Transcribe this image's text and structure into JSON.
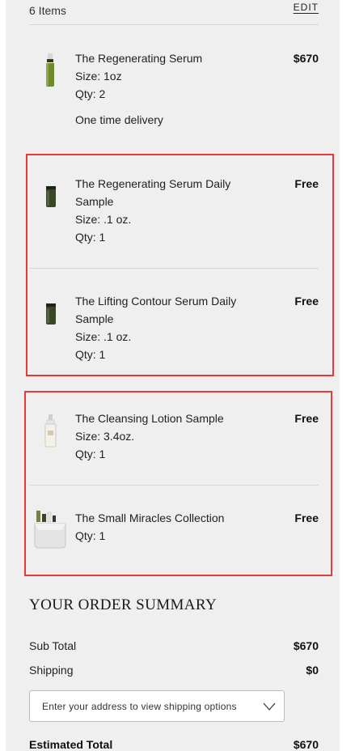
{
  "cart": {
    "items_count": "6 Items",
    "edit_label": "EDIT"
  },
  "items": [
    {
      "name": "The Regenerating Serum",
      "size": "Size: 1oz",
      "qty": "Qty: 2",
      "delivery": "One time delivery",
      "price": "$670",
      "icon": "serum-bottle-icon"
    },
    {
      "name": "The Regenerating Serum Daily Sample",
      "size": "Size: .1 oz.",
      "qty": "Qty: 1",
      "price": "Free",
      "icon": "sample-tube-icon"
    },
    {
      "name": "The Lifting Contour Serum Daily Sample",
      "size": "Size: .1 oz.",
      "qty": "Qty: 1",
      "price": "Free",
      "icon": "sample-tube-icon"
    },
    {
      "name": "The Cleansing Lotion Sample",
      "size": "Size: 3.4oz.",
      "qty": "Qty: 1",
      "price": "Free",
      "icon": "lotion-bottle-icon"
    },
    {
      "name": "The Small Miracles Collection",
      "qty": "Qty: 1",
      "price": "Free",
      "icon": "gift-set-icon"
    }
  ],
  "summary": {
    "title": "YOUR ORDER SUMMARY",
    "subtotal_label": "Sub Total",
    "subtotal_value": "$670",
    "shipping_label": "Shipping",
    "shipping_value": "$0",
    "address_placeholder": "Enter your address to view shipping options",
    "total_label": "Estimated Total",
    "total_value": "$670"
  },
  "colors": {
    "panel_bg": "#efefef",
    "highlight": "#e23b3b"
  }
}
